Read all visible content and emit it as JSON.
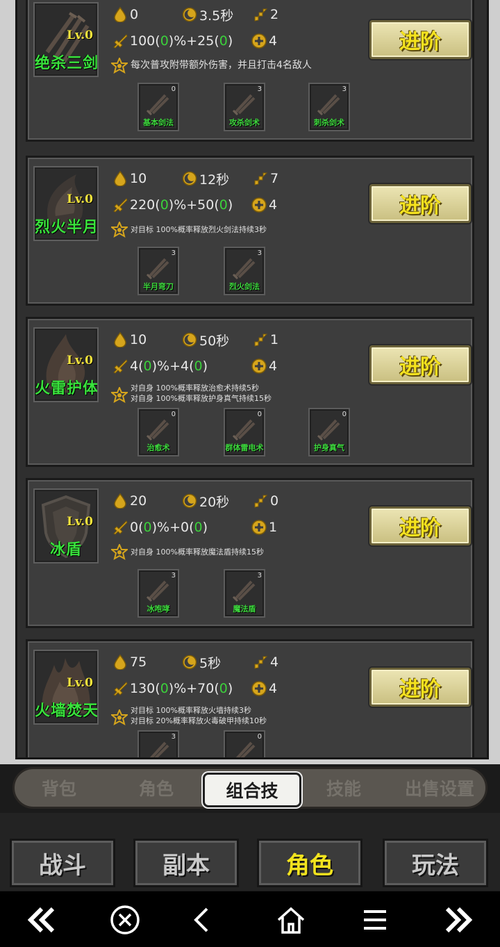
{
  "skills": [
    {
      "level": "Lv.0",
      "name": "绝杀三剑",
      "mp": "0",
      "cd": "3.5秒",
      "stage": "2",
      "dmg_a": "100(",
      "dmg_g1": "0",
      "dmg_b": ")%+25(",
      "dmg_g2": "0",
      "dmg_c": ")",
      "targets": "4",
      "desc": [
        "每次普攻附带额外伤害，并且打击4名敌人"
      ],
      "subs": [
        {
          "label": "基本剑法",
          "count": "0"
        },
        {
          "label": "攻杀剑术",
          "count": "3"
        },
        {
          "label": "刺杀剑术",
          "count": "3"
        }
      ]
    },
    {
      "level": "Lv.0",
      "name": "烈火半月",
      "mp": "10",
      "cd": "12秒",
      "stage": "7",
      "dmg_a": "220(",
      "dmg_g1": "0",
      "dmg_b": ")%+50(",
      "dmg_g2": "0",
      "dmg_c": ")",
      "targets": "4",
      "desc": [
        "对目标 100%概率释放烈火剑法持续3秒"
      ],
      "subs": [
        {
          "label": "半月弯刀",
          "count": "3"
        },
        {
          "label": "烈火剑法",
          "count": "3"
        }
      ]
    },
    {
      "level": "Lv.0",
      "name": "火雷护体",
      "mp": "10",
      "cd": "50秒",
      "stage": "1",
      "dmg_a": "4(",
      "dmg_g1": "0",
      "dmg_b": ")%+4(",
      "dmg_g2": "0",
      "dmg_c": ")",
      "targets": "4",
      "desc": [
        "对自身 100%概率释放治愈术持续5秒",
        "对自身 100%概率释放护身真气持续15秒"
      ],
      "subs": [
        {
          "label": "治愈术",
          "count": "0"
        },
        {
          "label": "群体雷电术",
          "count": "0"
        },
        {
          "label": "护身真气",
          "count": "0"
        }
      ]
    },
    {
      "level": "Lv.0",
      "name": "冰盾",
      "mp": "20",
      "cd": "20秒",
      "stage": "0",
      "dmg_a": "0(",
      "dmg_g1": "0",
      "dmg_b": ")%+0(",
      "dmg_g2": "0",
      "dmg_c": ")",
      "targets": "1",
      "desc": [
        "对自身 100%概率释放魔法盾持续15秒"
      ],
      "subs": [
        {
          "label": "冰咆哮",
          "count": "3"
        },
        {
          "label": "魔法盾",
          "count": "3"
        }
      ]
    },
    {
      "level": "Lv.0",
      "name": "火墙焚天",
      "mp": "75",
      "cd": "5秒",
      "stage": "4",
      "dmg_a": "130(",
      "dmg_g1": "0",
      "dmg_b": ")%+70(",
      "dmg_g2": "0",
      "dmg_c": ")",
      "targets": "4",
      "desc": [
        "对目标 100%概率释放火墙持续3秒",
        "对目标 20%概率释放火毒破甲持续10秒"
      ],
      "subs": [
        {
          "label": "",
          "count": "3"
        },
        {
          "label": "",
          "count": "0"
        }
      ]
    }
  ],
  "advance_label": "进阶",
  "tabs": [
    "背包",
    "角色",
    "组合技",
    "技能",
    "出售设置"
  ],
  "active_tab": "组合技",
  "main_buttons": [
    "战斗",
    "副本",
    "角色",
    "玩法"
  ],
  "active_main": "角色",
  "colors": {
    "accent_yellow": "#f2e31e",
    "name_green": "#39e23c",
    "panel_dark": "#2f2f2f"
  }
}
